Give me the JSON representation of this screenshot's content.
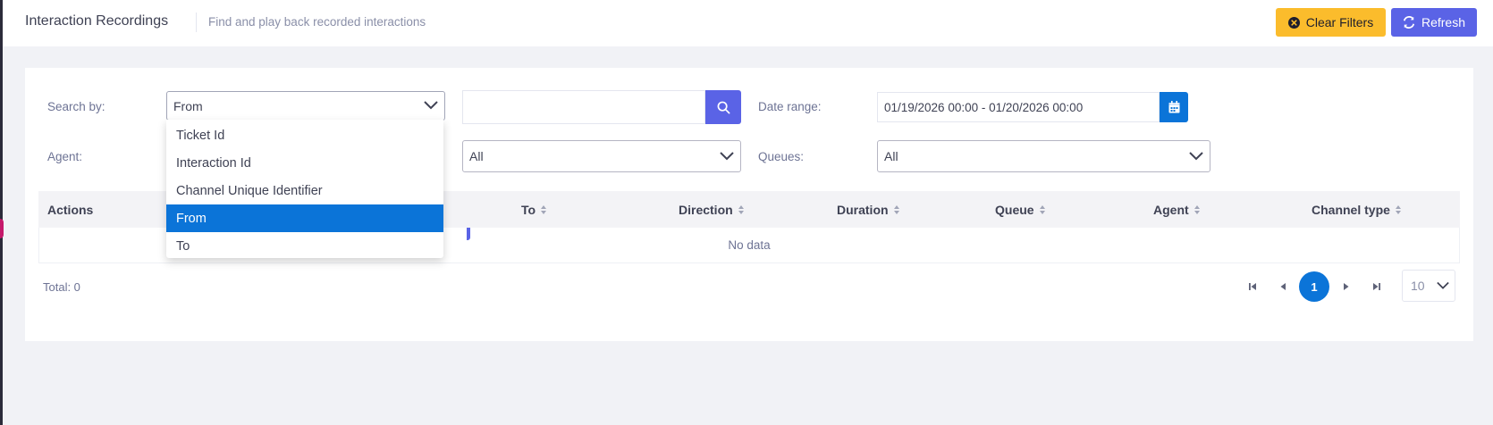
{
  "header": {
    "title": "Interaction Recordings",
    "subtitle": "Find and play back recorded interactions",
    "clear_filters_label": "Clear Filters",
    "refresh_label": "Refresh"
  },
  "filters": {
    "search_by_label": "Search by:",
    "search_by_value": "From",
    "search_by_options": [
      "Ticket Id",
      "Interaction Id",
      "Channel Unique Identifier",
      "From",
      "To"
    ],
    "search_text_value": "",
    "date_range_label": "Date range:",
    "date_range_value": "01/19/2026 00:00 - 01/20/2026 00:00",
    "agent_label": "Agent:",
    "agent_sub_value": "All",
    "queues_label": "Queues:",
    "queues_value": "All"
  },
  "table": {
    "columns": [
      "Actions",
      "To",
      "Direction",
      "Duration",
      "Queue",
      "Agent",
      "Channel type"
    ],
    "empty_text": "No data"
  },
  "footer": {
    "total_text": "Total: 0",
    "current_page": "1",
    "page_size": "10"
  },
  "colors": {
    "primary": "#5a63e6",
    "accent_blue": "#0b74d8",
    "warning": "#fbbc2c"
  },
  "icons": [
    "close-circle-icon",
    "refresh-icon",
    "search-icon",
    "calendar-icon",
    "chevron-down-icon",
    "sort-icon",
    "first-page-icon",
    "prev-page-icon",
    "next-page-icon",
    "last-page-icon"
  ]
}
